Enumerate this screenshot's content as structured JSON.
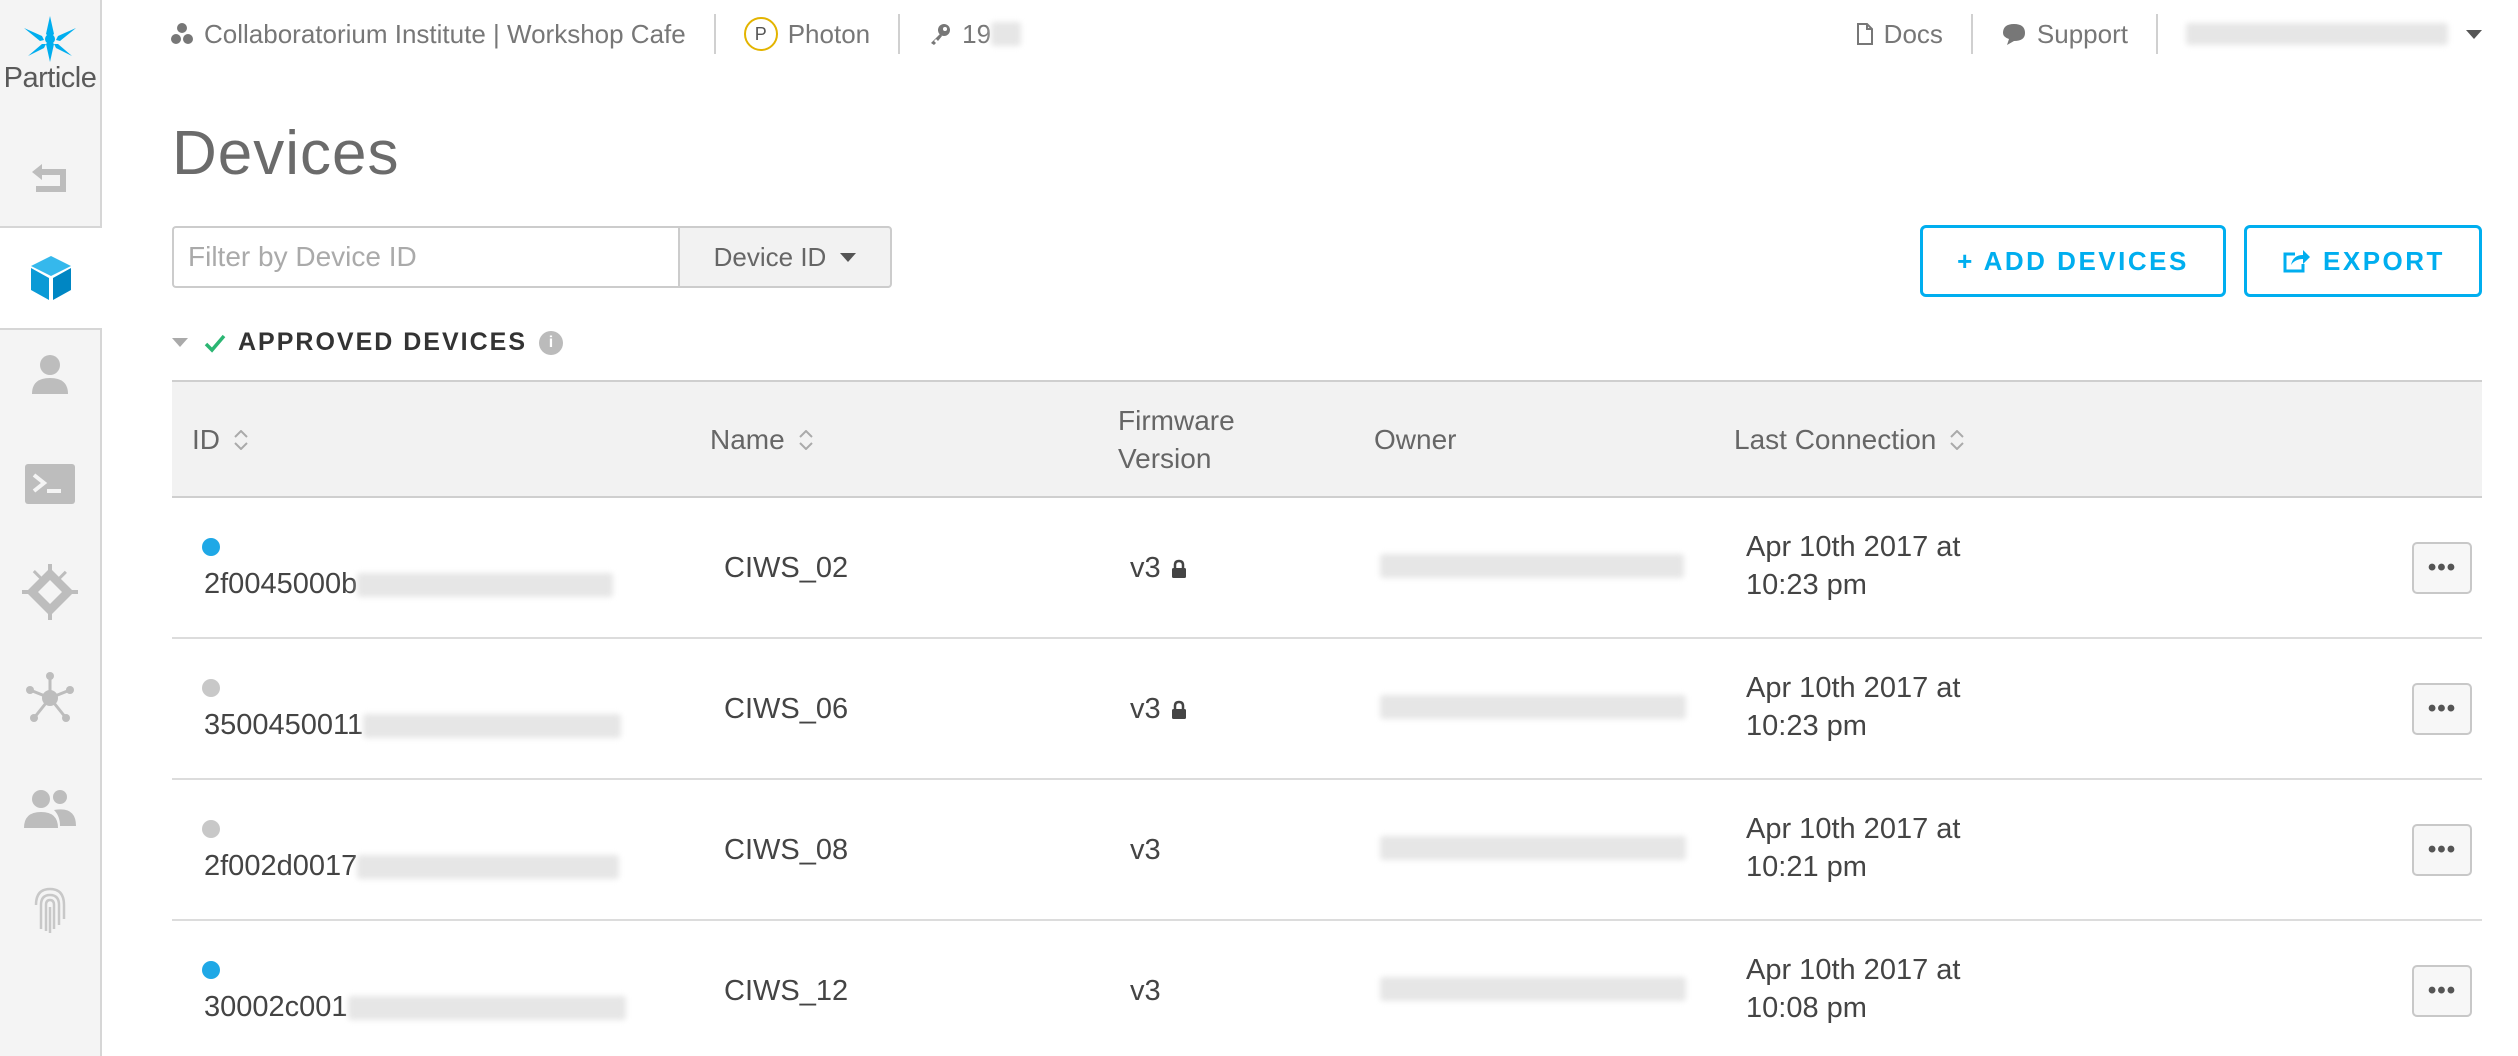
{
  "app": {
    "brand": "Particle",
    "accent_color": "#00aeef"
  },
  "sidebar": {
    "items": [
      {
        "name": "back",
        "icon": "back-arrow-icon"
      },
      {
        "name": "devices",
        "icon": "cube-icon",
        "active": true
      },
      {
        "name": "customers",
        "icon": "user-icon"
      },
      {
        "name": "console",
        "icon": "terminal-icon"
      },
      {
        "name": "firmware",
        "icon": "chip-icon"
      },
      {
        "name": "integrations",
        "icon": "network-icon"
      },
      {
        "name": "team",
        "icon": "team-icon"
      },
      {
        "name": "authentication",
        "icon": "fingerprint-icon"
      }
    ]
  },
  "topbar": {
    "organization": "Collaboratorium Institute | Workshop Cafe",
    "product_badge": "P",
    "product_name": "Photon",
    "product_id_prefix": "19",
    "docs_label": "Docs",
    "support_label": "Support"
  },
  "page": {
    "title": "Devices"
  },
  "filter": {
    "placeholder": "Filter by Device ID",
    "value": "",
    "select_selected": "Device ID"
  },
  "actions": {
    "add_label": "+ ADD DEVICES",
    "export_label": "EXPORT"
  },
  "section": {
    "title": "APPROVED DEVICES"
  },
  "table": {
    "columns": {
      "id": "ID",
      "name": "Name",
      "firmware_line1": "Firmware",
      "firmware_line2": "Version",
      "owner": "Owner",
      "last_connection": "Last Connection"
    },
    "rows": [
      {
        "id_visible": "2f0045000b",
        "online": true,
        "status_color": "#1fa8e6",
        "name": "CIWS_02",
        "firmware": "v3",
        "locked": true,
        "last_line1": "Apr 10th 2017 at",
        "last_line2": "10:23 pm",
        "more": "•••"
      },
      {
        "id_visible": "3500450011",
        "online": false,
        "status_color": "#c8c8c8",
        "name": "CIWS_06",
        "firmware": "v3",
        "locked": true,
        "last_line1": "Apr 10th 2017 at",
        "last_line2": "10:23 pm",
        "more": "•••"
      },
      {
        "id_visible": "2f002d0017",
        "online": false,
        "status_color": "#c8c8c8",
        "name": "CIWS_08",
        "firmware": "v3",
        "locked": false,
        "last_line1": "Apr 10th 2017 at",
        "last_line2": "10:21 pm",
        "more": "•••"
      },
      {
        "id_visible": "30002c001",
        "online": true,
        "status_color": "#1fa8e6",
        "name": "CIWS_12",
        "firmware": "v3",
        "locked": false,
        "last_line1": "Apr 10th 2017 at",
        "last_line2": "10:08 pm",
        "more": "•••"
      }
    ]
  }
}
